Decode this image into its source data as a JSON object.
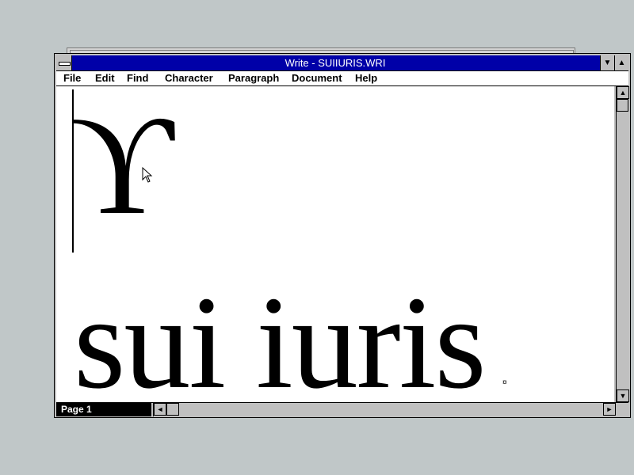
{
  "window": {
    "title": "Write - SUIIURIS.WRI"
  },
  "menu": [
    {
      "label": "File"
    },
    {
      "label": "Edit"
    },
    {
      "label": "Find"
    },
    {
      "label": "Character"
    },
    {
      "label": "Paragraph"
    },
    {
      "label": "Document"
    },
    {
      "label": "Help"
    }
  ],
  "document": {
    "glyph": "ϒ",
    "text": "sui iuris",
    "end_mark": "¤"
  },
  "status": {
    "page_label": "Page 1"
  },
  "icons": {
    "system_menu": "system-menu-icon",
    "minimize": "minimize-icon",
    "maximize": "maximize-icon",
    "scroll_up": "arrow-up-icon",
    "scroll_down": "arrow-down-icon",
    "scroll_left": "arrow-left-icon",
    "scroll_right": "arrow-right-icon",
    "mouse_cursor": "mouse-pointer-icon"
  },
  "colors": {
    "titlebar": "#0000a8",
    "desktop": "#c0c7c8"
  }
}
